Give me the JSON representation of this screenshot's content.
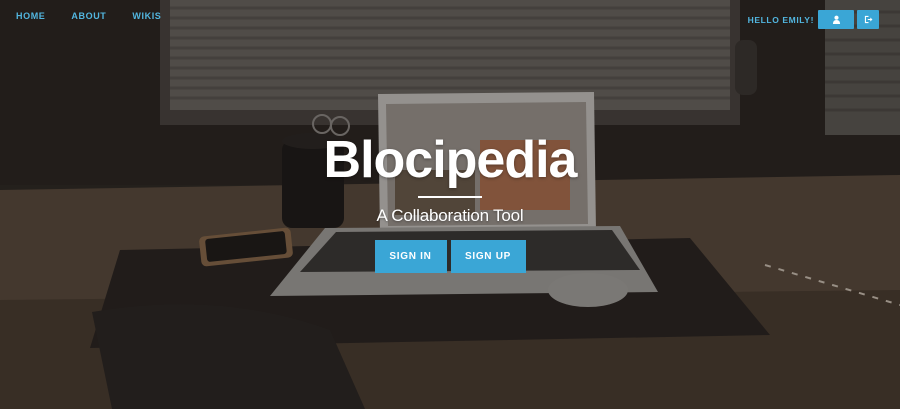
{
  "nav": {
    "links": [
      "HOME",
      "ABOUT",
      "WIKIS"
    ],
    "greeting": "HELLO EMILY!",
    "icons": [
      "user-icon",
      "sign-out-icon"
    ]
  },
  "hero": {
    "title": "Blocipedia",
    "subtitle": "A Collaboration Tool",
    "sign_in_label": "SIGN IN",
    "sign_up_label": "SIGN UP"
  },
  "colors": {
    "accent": "#3aa6d6",
    "nav_text": "#52b6e0",
    "heading": "#ffffff"
  }
}
